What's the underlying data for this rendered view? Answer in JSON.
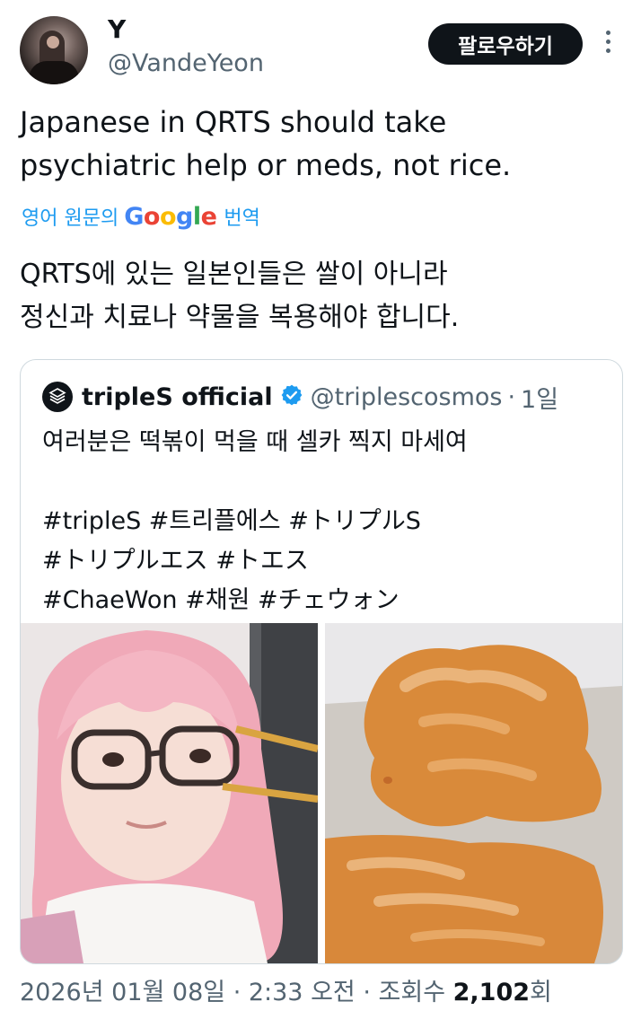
{
  "author": {
    "display_name": "Y",
    "handle": "@VandeYeon",
    "avatar_icon": "profile-photo"
  },
  "actions": {
    "follow_label": "팔로우하기",
    "more_icon": "vertical-ellipsis-icon"
  },
  "tweet": {
    "text_lines": [
      "Japanese in QRTS should take",
      "psychiatric help or meds, not rice."
    ]
  },
  "translation": {
    "source_label": "영어 원문의",
    "provider": "Google",
    "action_label": "번역",
    "text_lines": [
      "QRTS에 있는 일본인들은 쌀이 아니라",
      "정신과 치료나 약물을 복용해야 합니다."
    ],
    "link_color": "#1d9bf0"
  },
  "quoted": {
    "name": "tripleS official",
    "verified_icon": "verified-badge-icon",
    "verified_color": "#1d9bf0",
    "handle": "@triplescosmos",
    "separator": "·",
    "time": "1일",
    "text_line1": "여러분은 떡볶이 먹을 때 셀카 찍지 마세여",
    "hashtag_lines": [
      "#tripleS #트리플에스 #トリプルS",
      "#トリプルエス #トエス",
      "#ChaeWon #채원 #チェウォン"
    ],
    "media": [
      {
        "kind": "photo",
        "subject": "selfie-pink-hair-glasses-chopsticks"
      },
      {
        "kind": "photo",
        "subject": "spilled-tteokbokki"
      }
    ]
  },
  "meta": {
    "date_time": "2026년 01월 08일 · 2:33 오전 ·",
    "views_label": "조회수",
    "views_count": "2,102",
    "views_suffix": "회"
  }
}
